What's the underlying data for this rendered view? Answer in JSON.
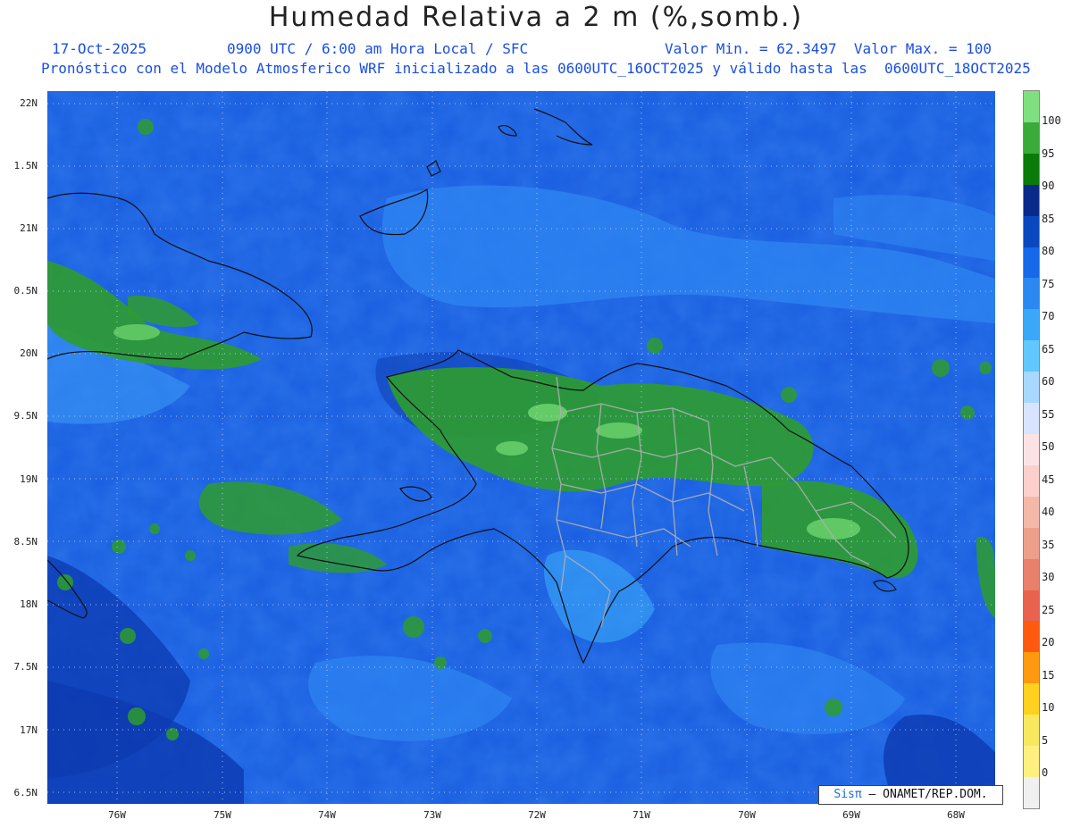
{
  "title": "Humedad Relativa a 2 m (%,somb.)",
  "subtitle": {
    "date": "17-Oct-2025",
    "time": "0900 UTC / 6:00 am Hora Local / SFC",
    "minmax": "Valor Min. = 62.3497  Valor Max. = 100",
    "model": "Pronóstico con el Modelo Atmosferico WRF inicializado a las 0600UTC_16OCT2025 y válido hasta las  0600UTC_18OCT2025"
  },
  "axes": {
    "lat_labels": [
      "22N",
      "1.5N",
      "21N",
      "0.5N",
      "20N",
      "9.5N",
      "19N",
      "8.5N",
      "18N",
      "7.5N",
      "17N",
      "6.5N"
    ],
    "lon_labels": [
      "76W",
      "75W",
      "74W",
      "73W",
      "72W",
      "71W",
      "70W",
      "69W",
      "68W"
    ]
  },
  "colorbar": {
    "labels": [
      "100",
      "95",
      "90",
      "85",
      "80",
      "75",
      "70",
      "65",
      "60",
      "55",
      "50",
      "45",
      "40",
      "35",
      "30",
      "25",
      "20",
      "15",
      "10",
      "5",
      "0"
    ],
    "colors": [
      "#7fe07f",
      "#3aaa3a",
      "#0a7a0a",
      "#0a2a8a",
      "#0a48c0",
      "#1568e8",
      "#2a88f0",
      "#3aa8f8",
      "#60c8ff",
      "#a8d8ff",
      "#d8e4ff",
      "#fde2e4",
      "#fbd0cc",
      "#f4b8a8",
      "#ee9f8b",
      "#e8806c",
      "#e8624e",
      "#ff5a10",
      "#ff9a10",
      "#ffd020",
      "#f8e860",
      "#fff080",
      "#f0f0f0"
    ]
  },
  "credit": {
    "logo": "Sisπ",
    "text": "– ONAMET/REP.DOM."
  }
}
